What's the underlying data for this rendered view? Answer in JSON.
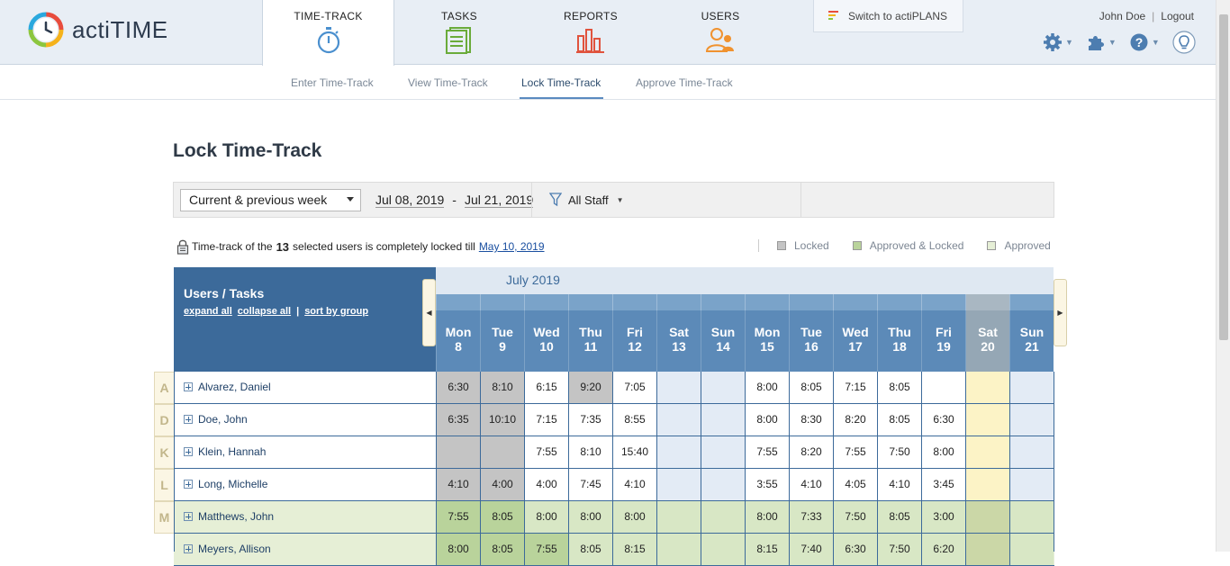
{
  "app": {
    "logo_text": "actiTIME"
  },
  "nav": {
    "tabs": [
      {
        "label": "TIME-TRACK",
        "icon": "stopwatch-icon"
      },
      {
        "label": "TASKS",
        "icon": "tasks-icon"
      },
      {
        "label": "REPORTS",
        "icon": "reports-icon"
      },
      {
        "label": "USERS",
        "icon": "users-icon"
      }
    ],
    "switch_label": "Switch to actiPLANS",
    "user_name": "John Doe",
    "logout_label": "Logout"
  },
  "subnav": {
    "items": [
      "Enter Time-Track",
      "View Time-Track",
      "Lock Time-Track",
      "Approve Time-Track"
    ],
    "active": "Lock Time-Track"
  },
  "page": {
    "title": "Lock Time-Track",
    "period_select": "Current & previous week",
    "date_from": "Jul 08, 2019",
    "date_sep": "-",
    "date_to": "Jul 21, 2019",
    "staff_filter": "All Staff",
    "lock_info_pre": "Time-track of the",
    "lock_info_count": "13",
    "lock_info_mid": "selected users is completely locked till",
    "lock_info_date": "May 10, 2019"
  },
  "legend": [
    {
      "label": "Locked",
      "color": "#c4c4c4"
    },
    {
      "label": "Approved & Locked",
      "color": "#b9d39b"
    },
    {
      "label": "Approved",
      "color": "#e6efd6"
    }
  ],
  "grid": {
    "users_header": "Users / Tasks",
    "expand_all": "expand all",
    "collapse_all": "collapse all",
    "divider": "|",
    "sort_by_group": "sort by group",
    "month": "July 2019",
    "days": [
      {
        "dow": "Mon",
        "num": "8"
      },
      {
        "dow": "Tue",
        "num": "9"
      },
      {
        "dow": "Wed",
        "num": "10"
      },
      {
        "dow": "Thu",
        "num": "11"
      },
      {
        "dow": "Fri",
        "num": "12"
      },
      {
        "dow": "Sat",
        "num": "13"
      },
      {
        "dow": "Sun",
        "num": "14"
      },
      {
        "dow": "Mon",
        "num": "15"
      },
      {
        "dow": "Tue",
        "num": "16"
      },
      {
        "dow": "Wed",
        "num": "17"
      },
      {
        "dow": "Thu",
        "num": "18"
      },
      {
        "dow": "Fri",
        "num": "19"
      },
      {
        "dow": "Sat",
        "num": "20"
      },
      {
        "dow": "Sun",
        "num": "21"
      }
    ],
    "rows": [
      {
        "letter": "A",
        "name": "Alvarez, Daniel",
        "values": [
          "6:30",
          "8:10",
          "6:15",
          "9:20",
          "7:05",
          "",
          "",
          "8:00",
          "8:05",
          "7:15",
          "8:05",
          "",
          "",
          ""
        ],
        "states": [
          "locked",
          "locked",
          "white",
          "locked",
          "white",
          "week",
          "week",
          "white",
          "white",
          "white",
          "white",
          "white",
          "sat20",
          "week"
        ]
      },
      {
        "letter": "D",
        "name": "Doe, John",
        "values": [
          "6:35",
          "10:10",
          "7:15",
          "7:35",
          "8:55",
          "",
          "",
          "8:00",
          "8:30",
          "8:20",
          "8:05",
          "6:30",
          "",
          ""
        ],
        "states": [
          "locked",
          "locked",
          "white",
          "white",
          "white",
          "week",
          "week",
          "white",
          "white",
          "white",
          "white",
          "white",
          "sat20",
          "week"
        ]
      },
      {
        "letter": "K",
        "name": "Klein, Hannah",
        "values": [
          "",
          "",
          "7:55",
          "8:10",
          "15:40",
          "",
          "",
          "7:55",
          "8:20",
          "7:55",
          "7:50",
          "8:00",
          "",
          ""
        ],
        "states": [
          "locked",
          "locked",
          "white",
          "white",
          "white",
          "week",
          "week",
          "white",
          "white",
          "white",
          "white",
          "white",
          "sat20",
          "week"
        ]
      },
      {
        "letter": "L",
        "name": "Long, Michelle",
        "values": [
          "4:10",
          "4:00",
          "4:00",
          "7:45",
          "4:10",
          "",
          "",
          "3:55",
          "4:10",
          "4:05",
          "4:10",
          "3:45",
          "",
          ""
        ],
        "states": [
          "locked",
          "locked",
          "white",
          "white",
          "white",
          "week",
          "week",
          "white",
          "white",
          "white",
          "white",
          "white",
          "sat20",
          "week"
        ]
      },
      {
        "letter": "M",
        "name": "Matthews, John",
        "values": [
          "7:55",
          "8:05",
          "8:00",
          "8:00",
          "8:00",
          "",
          "",
          "8:00",
          "7:33",
          "7:50",
          "8:05",
          "3:00",
          "",
          ""
        ],
        "states": [
          "apprlocked",
          "apprlocked",
          "appr",
          "appr",
          "appr",
          "appr",
          "appr",
          "appr",
          "appr",
          "appr",
          "appr",
          "appr",
          "apprsat",
          "appr"
        ]
      },
      {
        "letter": "",
        "name": "Meyers, Allison",
        "values": [
          "8:00",
          "8:05",
          "7:55",
          "8:05",
          "8:15",
          "",
          "",
          "8:15",
          "7:40",
          "6:30",
          "7:50",
          "6:20",
          "",
          ""
        ],
        "states": [
          "apprlocked",
          "apprlocked",
          "apprlocked",
          "appr",
          "appr",
          "appr",
          "appr",
          "appr",
          "appr",
          "appr",
          "appr",
          "appr",
          "apprsat",
          "appr"
        ]
      }
    ]
  }
}
